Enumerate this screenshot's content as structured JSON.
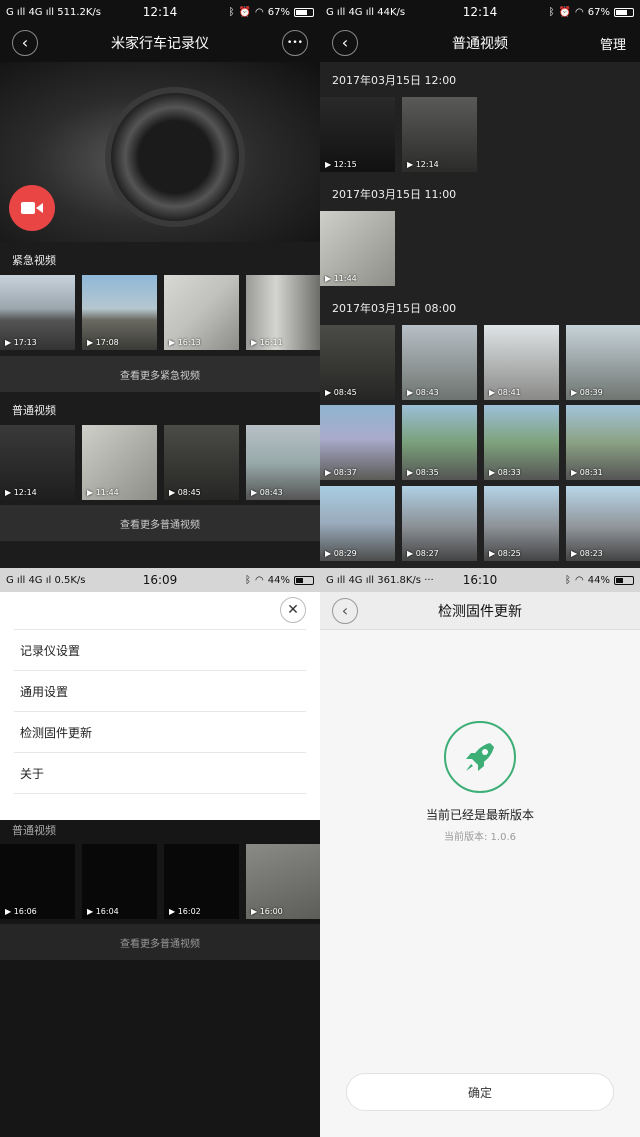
{
  "q1": {
    "status": {
      "left": "G ıll 4G ıll 511.2K/s",
      "time": "12:14",
      "battery": "67%",
      "battery_level": 0.67
    },
    "nav": {
      "title": "米家行车记录仪",
      "more": "•••"
    },
    "emergency": {
      "title": "紧急视频",
      "items": [
        {
          "time": "17:13"
        },
        {
          "time": "17:08"
        },
        {
          "time": "16:13"
        },
        {
          "time": "16:11"
        }
      ],
      "more": "查看更多紧急视频"
    },
    "normal": {
      "title": "普通视频",
      "items": [
        {
          "time": "12:14"
        },
        {
          "time": "11:44"
        },
        {
          "time": "08:45"
        },
        {
          "time": "08:43"
        }
      ],
      "more": "查看更多普通视频"
    }
  },
  "q2": {
    "status": {
      "left": "G ıll 4G ıll 44K/s",
      "time": "12:14",
      "battery": "67%",
      "battery_level": 0.67
    },
    "nav": {
      "title": "普通视频",
      "manage": "管理"
    },
    "groups": [
      {
        "date": "2017年03月15日  12:00",
        "items": [
          {
            "time": "12:15"
          },
          {
            "time": "12:14"
          }
        ]
      },
      {
        "date": "2017年03月15日  11:00",
        "items": [
          {
            "time": "11:44"
          }
        ]
      },
      {
        "date": "2017年03月15日  08:00",
        "items": [
          {
            "time": "08:45"
          },
          {
            "time": "08:43"
          },
          {
            "time": "08:41"
          },
          {
            "time": "08:39"
          },
          {
            "time": "08:37"
          },
          {
            "time": "08:35"
          },
          {
            "time": "08:33"
          },
          {
            "time": "08:31"
          },
          {
            "time": "08:29"
          },
          {
            "time": "08:27"
          },
          {
            "time": "08:25"
          },
          {
            "time": "08:23"
          }
        ]
      }
    ]
  },
  "q3": {
    "status": {
      "left": "G ıll 4G ıl  0.5K/s",
      "time": "16:09",
      "battery": "44%",
      "battery_level": 0.44
    },
    "menu": [
      "记录仪设置",
      "通用设置",
      "检测固件更新",
      "关于"
    ],
    "normal": {
      "title": "普通视频",
      "items": [
        {
          "time": "16:06"
        },
        {
          "time": "16:04"
        },
        {
          "time": "16:02"
        },
        {
          "time": "16:00"
        }
      ],
      "more": "查看更多普通视频"
    }
  },
  "q4": {
    "status": {
      "left": "G ıll 4G ıll  361.8K/s ···",
      "time": "16:10",
      "battery": "44%",
      "battery_level": 0.44
    },
    "nav": {
      "title": "检测固件更新"
    },
    "message": "当前已经是最新版本",
    "version": "当前版本: 1.0.6",
    "confirm": "确定",
    "accent": "#3dae76"
  }
}
